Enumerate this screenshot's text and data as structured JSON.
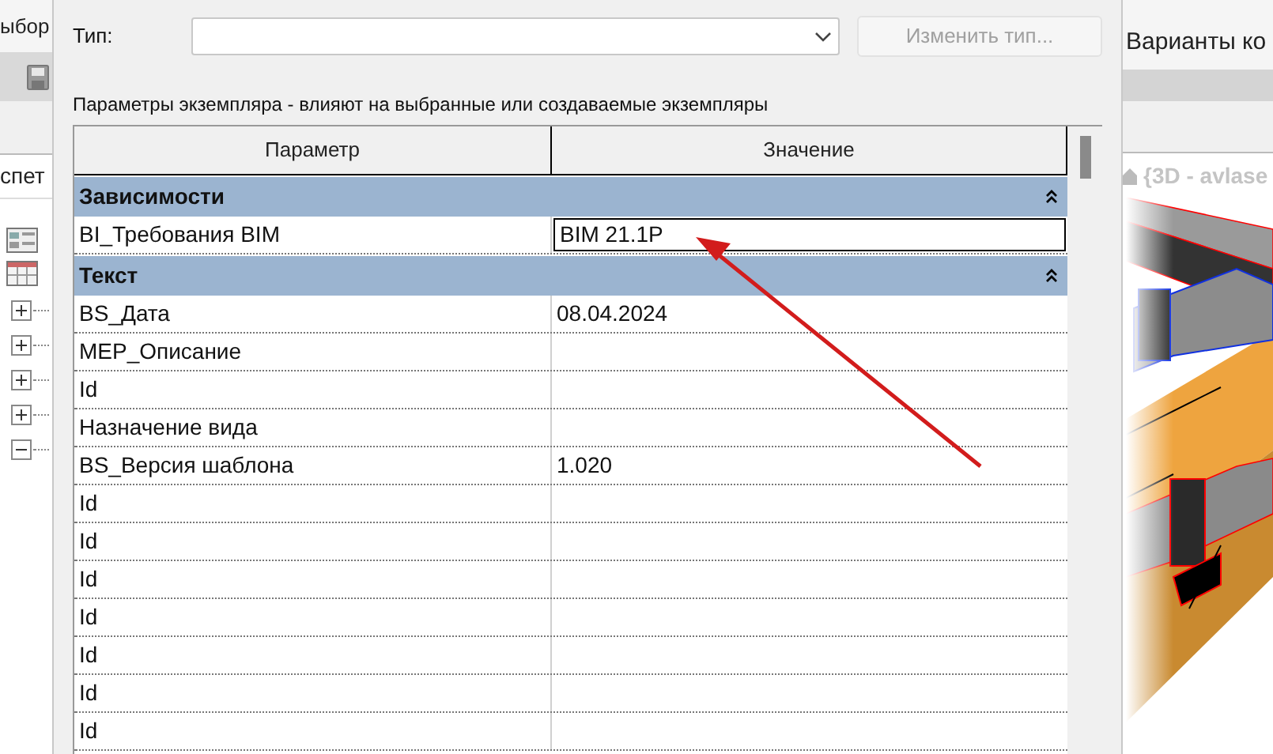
{
  "background_left": {
    "ribbon_text": "ыбор",
    "browser_title": "спет",
    "tree_nodes": [
      {
        "expanded": false
      },
      {
        "expanded": false
      },
      {
        "expanded": false
      },
      {
        "expanded": false
      },
      {
        "expanded": true
      }
    ]
  },
  "background_right": {
    "ribbon_text": "Варианты ко",
    "view_title": "{3D - avlase"
  },
  "dialog": {
    "type_label": "Тип:",
    "change_type_button": {
      "label": "Изменить тип...",
      "disabled": true
    },
    "instance_hint": "Параметры экземпляра - влияют на выбранные или создаваемые экземпляры",
    "table": {
      "columns": [
        "Параметр",
        "Значение"
      ],
      "groups": [
        {
          "name": "Зависимости",
          "expanded": true,
          "rows": [
            {
              "name": "BI_Требования BIM",
              "value": "BIM 21.1P",
              "selected": true
            }
          ]
        },
        {
          "name": "Текст",
          "expanded": true,
          "rows": [
            {
              "name": "BS_Дата",
              "value": "08.04.2024",
              "selected": false
            },
            {
              "name": "MEP_Описание",
              "selected": false
            },
            {
              "name": "Id",
              "selected": false
            },
            {
              "name": "Назначение вида",
              "selected": false
            },
            {
              "name": "BS_Версия шаблона",
              "value": "1.020",
              "selected": false
            },
            {
              "name": "Id",
              "selected": false
            },
            {
              "name": "Id",
              "selected": false
            },
            {
              "name": "Id",
              "selected": false
            },
            {
              "name": "Id",
              "selected": false
            },
            {
              "name": "Id",
              "selected": false
            },
            {
              "name": "Id",
              "selected": false
            },
            {
              "name": "Id",
              "selected": false
            }
          ]
        }
      ]
    }
  }
}
